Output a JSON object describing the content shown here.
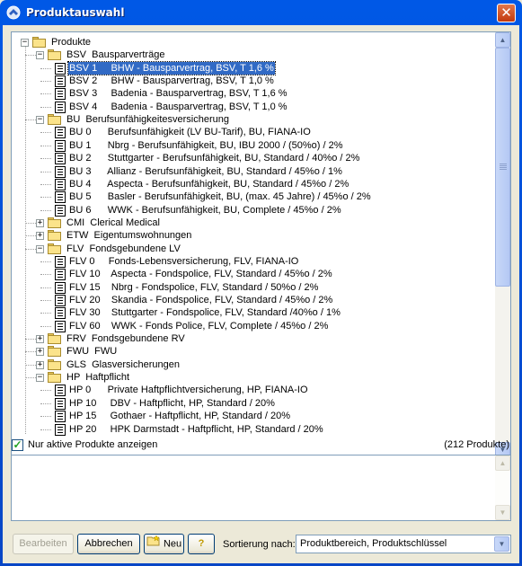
{
  "window": {
    "title": "Produktauswahl",
    "close": "✕"
  },
  "tree": {
    "rows": [
      {
        "level": 0,
        "type": "folder",
        "expander": "−",
        "code": "Produkte",
        "text": ""
      },
      {
        "level": 1,
        "type": "folder",
        "expander": "−",
        "code": "BSV",
        "text": "Bausparverträge"
      },
      {
        "level": 2,
        "type": "doc",
        "code": "BSV 1",
        "text": "BHW - Bausparvertrag, BSV, T 1,6 %",
        "selected": true
      },
      {
        "level": 2,
        "type": "doc",
        "code": "BSV 2",
        "text": "BHW - Bausparvertrag, BSV, T 1,0 %"
      },
      {
        "level": 2,
        "type": "doc",
        "code": "BSV 3",
        "text": "Badenia - Bausparvertrag, BSV, T 1,6 %"
      },
      {
        "level": 2,
        "type": "doc",
        "code": "BSV 4",
        "text": "Badenia - Bausparvertrag, BSV, T 1,0 %"
      },
      {
        "level": 1,
        "type": "folder",
        "expander": "−",
        "code": "BU",
        "text": "Berufsunfähigkeitesversicherung"
      },
      {
        "level": 2,
        "type": "doc",
        "code": "BU 0",
        "text": "Berufsunfähigkeit (LV BU-Tarif), BU, FIANA-IO"
      },
      {
        "level": 2,
        "type": "doc",
        "code": "BU 1",
        "text": "Nbrg - Berufsunfähigkeit, BU, IBU 2000 / (50%o) / 2%"
      },
      {
        "level": 2,
        "type": "doc",
        "code": "BU 2",
        "text": "Stuttgarter - Berufsunfähigkeit, BU, Standard / 40%o / 2%"
      },
      {
        "level": 2,
        "type": "doc",
        "code": "BU 3",
        "text": "Allianz - Berufsunfähigkeit, BU, Standard / 45%o / 1%"
      },
      {
        "level": 2,
        "type": "doc",
        "code": "BU 4",
        "text": "Aspecta - Berufsunfähigkeit, BU, Standard / 45%o / 2%"
      },
      {
        "level": 2,
        "type": "doc",
        "code": "BU 5",
        "text": "Basler - Berufsunfähigkeit, BU, (max. 45 Jahre) / 45%o / 2%"
      },
      {
        "level": 2,
        "type": "doc",
        "code": "BU 6",
        "text": "WWK - Berufsunfähigkeit, BU, Complete / 45%o / 2%"
      },
      {
        "level": 1,
        "type": "folder",
        "expander": "+",
        "code": "CMI",
        "text": "Clerical Medical"
      },
      {
        "level": 1,
        "type": "folder",
        "expander": "+",
        "code": "ETW",
        "text": "Eigentumswohnungen"
      },
      {
        "level": 1,
        "type": "folder",
        "expander": "−",
        "code": "FLV",
        "text": "Fondsgebundene LV"
      },
      {
        "level": 2,
        "type": "doc",
        "code": "FLV 0",
        "text": "Fonds-Lebensversicherung, FLV, FIANA-IO"
      },
      {
        "level": 2,
        "type": "doc",
        "code": "FLV 10",
        "text": "Aspecta - Fondspolice, FLV, Standard / 45%o / 2%"
      },
      {
        "level": 2,
        "type": "doc",
        "code": "FLV 15",
        "text": "Nbrg - Fondspolice, FLV, Standard / 50%o / 2%"
      },
      {
        "level": 2,
        "type": "doc",
        "code": "FLV 20",
        "text": "Skandia - Fondspolice, FLV, Standard / 45%o / 2%"
      },
      {
        "level": 2,
        "type": "doc",
        "code": "FLV 30",
        "text": "Stuttgarter - Fondspolice, FLV, Standard /40%o / 1%"
      },
      {
        "level": 2,
        "type": "doc",
        "code": "FLV 60",
        "text": "WWK - Fonds Police, FLV, Complete / 45%o / 2%"
      },
      {
        "level": 1,
        "type": "folder",
        "expander": "+",
        "code": "FRV",
        "text": "Fondsgebundene RV"
      },
      {
        "level": 1,
        "type": "folder",
        "expander": "+",
        "code": "FWU",
        "text": "FWU"
      },
      {
        "level": 1,
        "type": "folder",
        "expander": "+",
        "code": "GLS",
        "text": "Glasversicherungen"
      },
      {
        "level": 1,
        "type": "folder",
        "expander": "−",
        "code": "HP",
        "text": "Haftpflicht"
      },
      {
        "level": 2,
        "type": "doc",
        "code": "HP 0",
        "text": "Private Haftpflichtversicherung, HP, FIANA-IO"
      },
      {
        "level": 2,
        "type": "doc",
        "code": "HP 10",
        "text": "DBV - Haftpflicht, HP, Standard / 20%"
      },
      {
        "level": 2,
        "type": "doc",
        "code": "HP 15",
        "text": "Gothaer - Haftpflicht, HP, Standard / 20%"
      },
      {
        "level": 2,
        "type": "doc",
        "code": "HP 20",
        "text": "HPK Darmstadt - Haftpflicht, HP, Standard / 20%"
      }
    ]
  },
  "filter": {
    "checked": true,
    "label": "Nur aktive Produkte anzeigen",
    "count": "(212 Produkte)"
  },
  "buttons": {
    "edit": "Bearbeiten",
    "cancel": "Abbrechen",
    "new": "Neu",
    "help": "?"
  },
  "sort": {
    "label": "Sortierung nach:",
    "value": "Produktbereich, Produktschlüssel"
  },
  "icons": {
    "up": "▲",
    "down": "▼",
    "check": "✓",
    "combo": "▼"
  }
}
